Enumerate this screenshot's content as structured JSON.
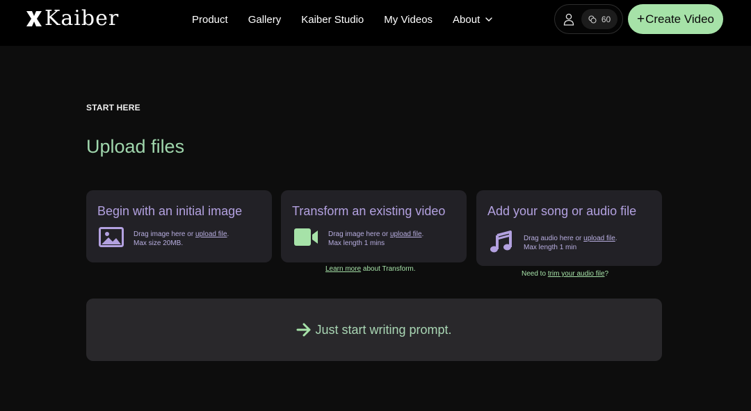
{
  "brand": {
    "name": "Kaiber"
  },
  "nav": {
    "links": [
      "Product",
      "Gallery",
      "Kaiber Studio",
      "My Videos",
      "About"
    ],
    "credits": "60",
    "create_label": "Create Video",
    "create_plus": "+"
  },
  "main": {
    "eyebrow": "START HERE",
    "title": "Upload files",
    "cards": [
      {
        "title": "Begin with an initial image",
        "line1_prefix": "Drag image here or ",
        "line1_link": "upload file",
        "line1_suffix": ".",
        "line2": "Max size 20MB.",
        "icon": "image-icon"
      },
      {
        "title": "Transform an existing video",
        "line1_prefix": "Drag image here or ",
        "line1_link": "upload file",
        "line1_suffix": ".",
        "line2": "Max length 1 mins",
        "icon": "video-camera-icon",
        "helper_link": "Learn more",
        "helper_suffix": " about Transform."
      },
      {
        "title": "Add your song or audio file",
        "line1_prefix": "Drag audio here or ",
        "line1_link": "upload file",
        "line1_suffix": ".",
        "line2": "Max length 1 min",
        "icon": "music-note-icon",
        "helper_prefix": "Need to ",
        "helper_link": "trim your audio file",
        "helper_suffix": "?"
      }
    ],
    "prompt_label": "Just start writing prompt."
  },
  "colors": {
    "accent_green": "#a6e2a8",
    "accent_purple": "#b3a1e0",
    "background": "#0d0d0d"
  }
}
